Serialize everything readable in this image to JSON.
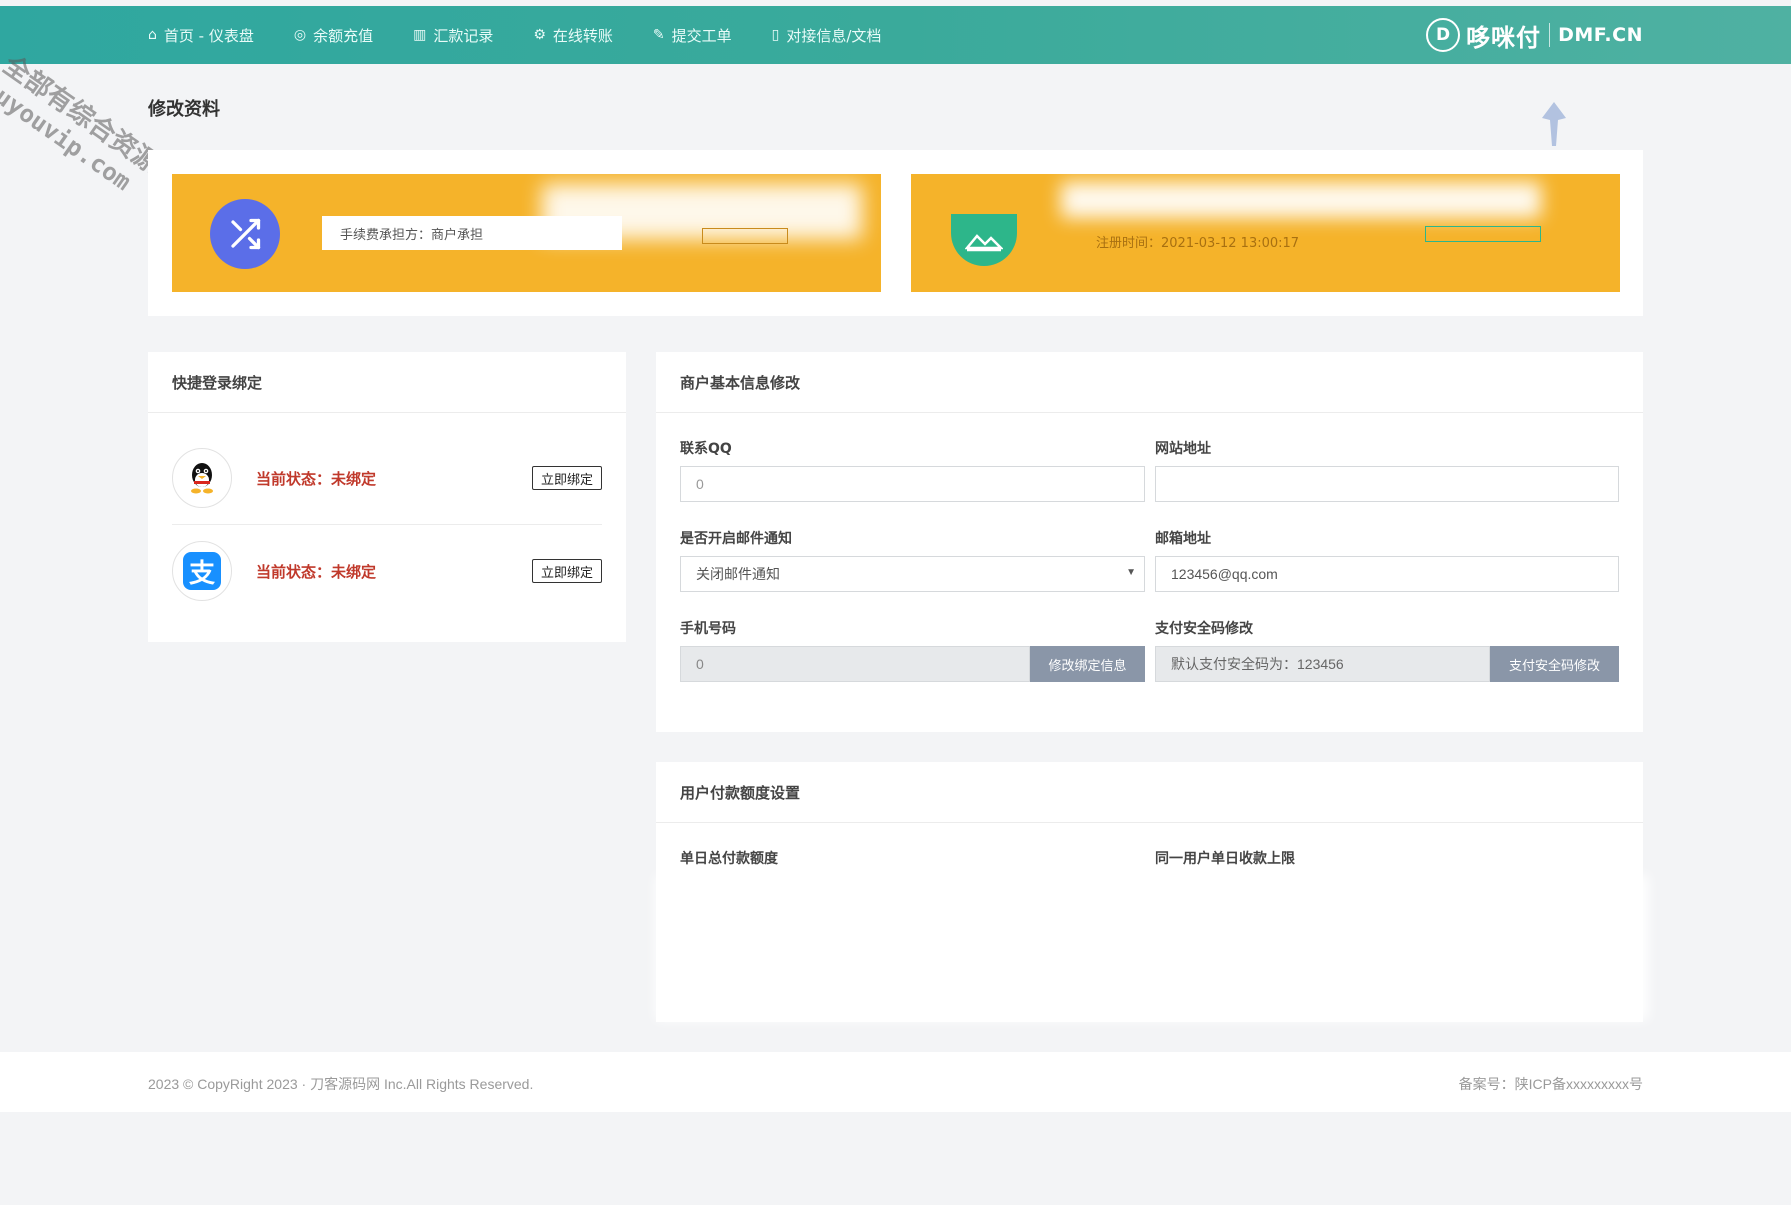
{
  "nav": {
    "items": [
      {
        "icon": "home-icon",
        "glyph": "⌂",
        "label": "首页 - 仪表盘"
      },
      {
        "icon": "circle-dot-icon",
        "glyph": "◎",
        "label": "余额充值"
      },
      {
        "icon": "bar-chart-icon",
        "glyph": "▥",
        "label": "汇款记录"
      },
      {
        "icon": "settings-icon",
        "glyph": "⚙",
        "label": "在线转账"
      },
      {
        "icon": "edit-icon",
        "glyph": "✎",
        "label": "提交工单"
      },
      {
        "icon": "document-icon",
        "glyph": "▯",
        "label": "对接信息/文档"
      }
    ],
    "brand": {
      "logo_glyph": "D",
      "name": "哆咪付",
      "domain": "DMF.CN"
    }
  },
  "watermark": {
    "line1": "全部有综合资源网",
    "line2": "douyouvip.com"
  },
  "page_title": "修改资料",
  "hero": {
    "fee_text": "手续费承担方：商户承担",
    "reg_text": "注册时间：2021-03-12 13:00:17"
  },
  "quick_login": {
    "title": "快捷登录绑定",
    "rows": [
      {
        "icon": "qq-icon",
        "status": "当前状态：未绑定",
        "button": "立即绑定"
      },
      {
        "icon": "alipay-icon",
        "status": "当前状态：未绑定",
        "button": "立即绑定"
      }
    ]
  },
  "merchant": {
    "title": "商户基本信息修改",
    "qq_label": "联系QQ",
    "qq_value": "0",
    "site_label": "网站地址",
    "site_value": "",
    "mail_notify_label": "是否开启邮件通知",
    "mail_notify_value": "关闭邮件通知",
    "email_label": "邮箱地址",
    "email_value": "123456@qq.com",
    "phone_label": "手机号码",
    "phone_value": "0",
    "phone_button": "修改绑定信息",
    "pay_code_label": "支付安全码修改",
    "pay_code_value": "默认支付安全码为：123456",
    "pay_code_button": "支付安全码修改"
  },
  "limits": {
    "title": "用户付款额度设置",
    "daily_total_label": "单日总付款额度",
    "per_user_label": "同一用户单日收款上限"
  },
  "footer": {
    "copyright": "2023 © CopyRight 2023 · 刀客源码网 Inc.All Rights Reserved.",
    "icp": "备案号：陕ICP备xxxxxxxxx号"
  },
  "colors": {
    "nav": "#3aaa9b",
    "hero": "#f5b32a",
    "status_red": "#c0392b",
    "grey_button": "#8a96a8"
  }
}
